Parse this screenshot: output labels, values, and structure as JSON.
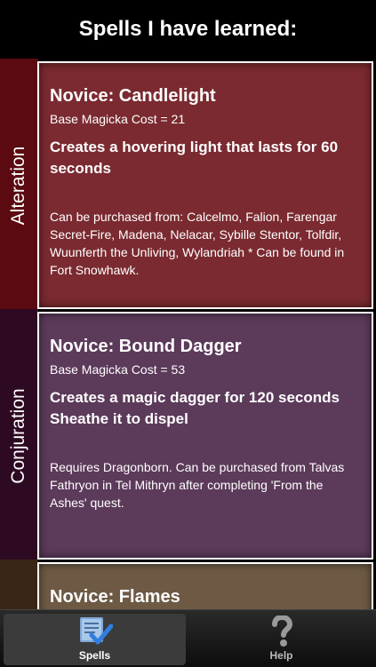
{
  "header": {
    "title": "Spells I have learned:"
  },
  "sections": [
    {
      "school": "Alteration",
      "spell": {
        "name": "Novice: Candlelight",
        "cost": "Base Magicka Cost = 21",
        "description": "Creates a hovering light that lasts for 60 seconds",
        "availability": "Can be purchased from: Calcelmo, Falion, Farengar Secret-Fire, Madena, Nelacar, Sybille Stentor, Tolfdir, Wuunferth the Unliving, Wylandriah * Can be found in Fort Snowhawk."
      }
    },
    {
      "school": "Conjuration",
      "spell": {
        "name": "Novice: Bound Dagger",
        "cost": "Base Magicka Cost = 53",
        "description": "Creates a magic dagger for 120 seconds Sheathe it to dispel",
        "availability": "Requires Dragonborn. Can be purchased from Talvas Fathryon in Tel Mithryn after completing 'From the Ashes' quest."
      }
    },
    {
      "school": "",
      "spell": {
        "name": "Novice: Flames"
      }
    }
  ],
  "tabs": [
    {
      "label": "Spells",
      "icon": "spellbook-check-icon",
      "selected": true
    },
    {
      "label": "Help",
      "icon": "question-mark-icon",
      "selected": false
    }
  ],
  "colors": {
    "alteration_card": "#7a2a30",
    "conjuration_card": "#5c3a5a",
    "destruction_card": "#6e5a44"
  }
}
